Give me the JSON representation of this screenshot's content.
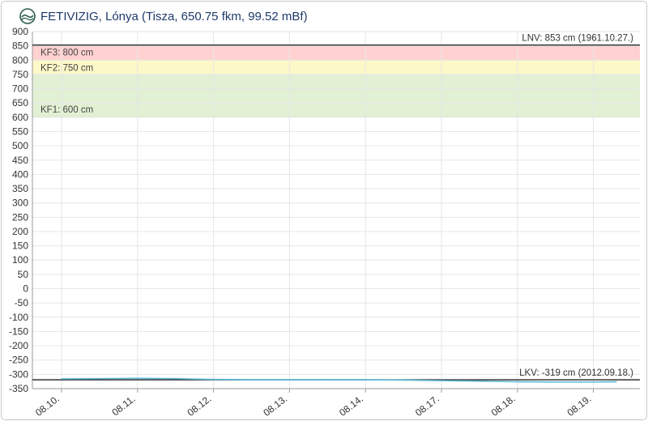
{
  "header": {
    "title": "FETIVIZIG, Lónya (Tisza, 650.75 fkm, 99.52 mBf)",
    "logo_icon": "fetivizig-wave-logo"
  },
  "colors": {
    "kf3": "#ffd1d1",
    "kf2": "#fdf8c8",
    "kf1": "#e2f0d3",
    "series": "#5bb8d6",
    "extreme_line": "#333333",
    "grid": "#e6e6e6",
    "title": "#1f3a6b"
  },
  "chart_data": {
    "type": "line",
    "ylim": [
      -350,
      900
    ],
    "yticks": [
      900,
      850,
      800,
      750,
      700,
      650,
      600,
      550,
      500,
      450,
      400,
      350,
      300,
      250,
      200,
      150,
      100,
      50,
      0,
      -50,
      -100,
      -150,
      -200,
      -250,
      -300,
      -350
    ],
    "xtick_labels": [
      "08.10.",
      "08.11.",
      "08.12.",
      "08.13.",
      "08.14.",
      "08.17.",
      "08.18.",
      "08.19."
    ],
    "grid": true,
    "bands": [
      {
        "label": "KF3: 800 cm",
        "from": 800,
        "to": 853
      },
      {
        "label": "KF2: 750 cm",
        "from": 750,
        "to": 800
      },
      {
        "label": "KF1: 600 cm",
        "from": 600,
        "to": 750
      }
    ],
    "extremes": [
      {
        "label": "LNV: 853 cm (1961.10.27.)",
        "value": 853
      },
      {
        "label": "LKV: -319 cm (2012.09.18.)",
        "value": -319
      }
    ],
    "series": [
      {
        "x": [
          0,
          0.5,
          1.0,
          1.5,
          2.0,
          2.5,
          3.0,
          3.5,
          4.0,
          4.5,
          5.0,
          5.5,
          6.0,
          6.5,
          7.0,
          7.3
        ],
        "values": [
          -316,
          -315,
          -314,
          -315,
          -318,
          -319,
          -319,
          -319,
          -319,
          -320,
          -322,
          -324,
          -326,
          -327,
          -327,
          -326
        ]
      }
    ]
  }
}
